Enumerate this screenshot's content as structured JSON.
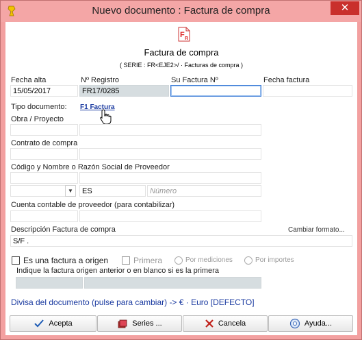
{
  "window": {
    "title": "Nuevo documento : Factura de compra",
    "close_label": "✕"
  },
  "header": {
    "title": "Factura de compra",
    "serie": "( SERIE : FR<EJE2>/ · Facturas de compra )"
  },
  "fields": {
    "fecha_alta": {
      "label": "Fecha alta",
      "value": "15/05/2017"
    },
    "num_registro": {
      "label": "Nº Registro",
      "value": "FR17/0285"
    },
    "su_factura": {
      "label": "Su Factura Nº",
      "value": ""
    },
    "fecha_factura": {
      "label": "Fecha factura",
      "value": ""
    },
    "tipo_documento": {
      "label": "Tipo documento:",
      "link": "F1 Factura"
    },
    "obra": {
      "label": "Obra / Proyecto"
    },
    "contrato": {
      "label": "Contrato de compra"
    },
    "proveedor": {
      "label": "Código y Nombre o Razón Social de Proveedor",
      "country": "ES",
      "numero_placeholder": "Número"
    },
    "cuenta": {
      "label": "Cuenta contable de proveedor (para contabilizar)"
    },
    "descripcion": {
      "label": "Descripción Factura de compra",
      "cambiar": "Cambiar formato...",
      "value": "S/F ."
    }
  },
  "origen": {
    "checkbox_label": "Es una factura a origen",
    "primera_label": "Primera",
    "por_mediciones": "Por mediciones",
    "por_importes": "Por importes",
    "indique_label": "Indique la factura origen anterior o en blanco si es la primera"
  },
  "divisa": "Divisa del documento (pulse para cambiar) -> € · Euro [DEFECTO]",
  "buttons": {
    "acepta": "Acepta",
    "series": "Series ...",
    "cancela": "Cancela",
    "ayuda": "Ayuda..."
  },
  "colors": {
    "titlebar": "#f4a6a6",
    "close": "#c9302c",
    "link": "#1a3aa0",
    "grey_field": "#d6dde0"
  }
}
